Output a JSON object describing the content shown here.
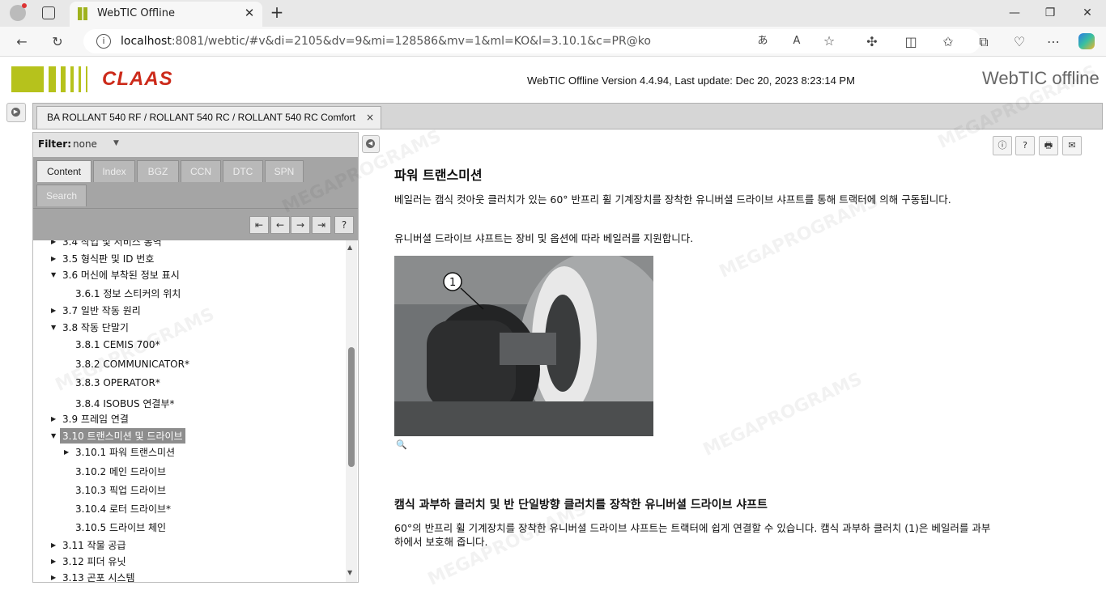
{
  "browser": {
    "tab_title": "WebTIC Offline",
    "url_host": "localhost",
    "url_rest": ":8081/webtic/#v&di=2105&dv=9&mi=128586&mv=1&ml=KO&l=3.10.1&c=PR@ko",
    "icons": [
      "profile-icon",
      "tab-actions-icon",
      "back-icon",
      "reload-icon",
      "read-aloud-icon",
      "favorite-icon",
      "extensions-icon",
      "split-screen-icon",
      "favorites-list-icon",
      "collections-icon",
      "performance-icon",
      "more-icon",
      "copilot-icon"
    ]
  },
  "header": {
    "brand": "CLAAS",
    "version": "WebTIC Offline Version 4.4.94, Last update: Dec 20, 2023 8:23:14 PM",
    "product": "WebTIC offline",
    "brand_color": "#cc2a1a",
    "accent_color": "#b6c21c"
  },
  "doc_tab": {
    "title": "BA ROLLANT 540 RF / ROLLANT 540 RC / ROLLANT 540 RC Comfort",
    "close": "×"
  },
  "left": {
    "filter_label": "Filter:",
    "filter_value": "none",
    "tabs": [
      "Content",
      "Index",
      "BGZ",
      "CCN",
      "DTC",
      "SPN",
      "Search"
    ],
    "nav": [
      "⇤",
      "←",
      "→",
      "⇥",
      "?"
    ],
    "tree": [
      {
        "label": "3.4 작업 및 서비스 통역",
        "arrow": "▶"
      },
      {
        "label": "3.5 형식판 및 ID 번호",
        "arrow": "▶"
      },
      {
        "label": "3.6 머신에 부착된 정보 표시",
        "arrow": "▼"
      },
      {
        "label": "3.6.1 정보 스티커의 위치",
        "arrow": ""
      },
      {
        "label": "3.7 일반 작동 원리",
        "arrow": "▶"
      },
      {
        "label": "3.8 작동 단말기",
        "arrow": "▼"
      },
      {
        "label": "3.8.1 CEMIS 700*",
        "arrow": ""
      },
      {
        "label": "3.8.2 COMMUNICATOR*",
        "arrow": ""
      },
      {
        "label": "3.8.3 OPERATOR*",
        "arrow": ""
      },
      {
        "label": "3.8.4 ISOBUS 연결부*",
        "arrow": ""
      },
      {
        "label": "3.9 프레임 연결",
        "arrow": "▶"
      },
      {
        "label": "3.10 트랜스미션 및 드라이브",
        "arrow": "▼"
      },
      {
        "label": "3.10.1 파워 트랜스미션",
        "arrow": "▶"
      },
      {
        "label": "3.10.2 메인 드라이브",
        "arrow": ""
      },
      {
        "label": "3.10.3 픽업 드라이브",
        "arrow": ""
      },
      {
        "label": "3.10.4 로터 드라이브*",
        "arrow": ""
      },
      {
        "label": "3.10.5 드라이브 체인",
        "arrow": ""
      },
      {
        "label": "3.11 작물 공급",
        "arrow": "▶"
      },
      {
        "label": "3.12 피더 유닛",
        "arrow": "▶"
      },
      {
        "label": "3.13 곤포 시스템",
        "arrow": "▶"
      }
    ]
  },
  "content": {
    "title": "파워 트랜스미션",
    "para1": "베일러는 캠식 컷아웃 클러치가 있는 60° 반프리 휠 기계장치를 장착한 유니버셜 드라이브 샤프트를 통해 트랙터에 의해 구동됩니다.",
    "para2": "유니버셜 드라이브 샤프트는 장비 및 옵션에 따라 베일러를 지원합니다.",
    "figure_callout": "1",
    "subtitle": "캠식 과부하 클러치 및 반 단일방향 클러치를 장착한 유니버셜 드라이브 샤프트",
    "para3": "60°의 반프리 휠 기계장치를 장착한 유니버셜 드라이브 샤프트는 트랙터에 쉽게 연결할 수 있습니다. 캠식 과부하 클러치 (1)은 베일러를 과부하에서 보호해 줍니다.",
    "buttons": [
      "ⓘ",
      "?",
      "🖶",
      "✉"
    ]
  },
  "watermark": "MEGAPROGRAMS"
}
